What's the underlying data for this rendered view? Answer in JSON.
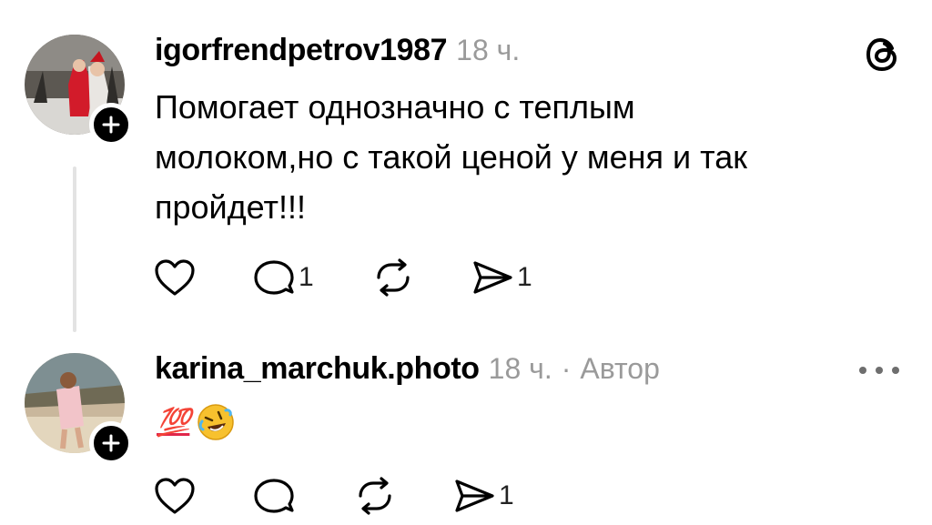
{
  "post": {
    "username": "igorfrendpetrov1987",
    "time": "18 ч.",
    "text_lines": [
      "Помогает однозначно с теплым",
      "молоком,но с такой ценой у меня и так",
      "пройдет!!!"
    ],
    "actions": {
      "like_icon": "heart-icon",
      "comment_icon": "comment-icon",
      "comment_count": "1",
      "repost_icon": "repost-icon",
      "share_icon": "share-icon",
      "share_count": "1"
    }
  },
  "app_icon": "threads-logo-icon",
  "reply": {
    "username": "karina_marchuk.photo",
    "time": "18 ч.",
    "separator": "·",
    "author_label": "Автор",
    "emoji_text": "💯",
    "emoji_face": "rolling-on-floor-laughing",
    "actions": {
      "like_icon": "heart-icon",
      "comment_icon": "comment-icon",
      "repost_icon": "repost-icon",
      "share_icon": "share-icon",
      "share_count": "1"
    },
    "more_icon": "more-options-icon"
  },
  "colors": {
    "text": "#000000",
    "meta": "#9a9a9a",
    "thread_line": "#e3e3e3",
    "emoji_100": "#e0264a"
  }
}
